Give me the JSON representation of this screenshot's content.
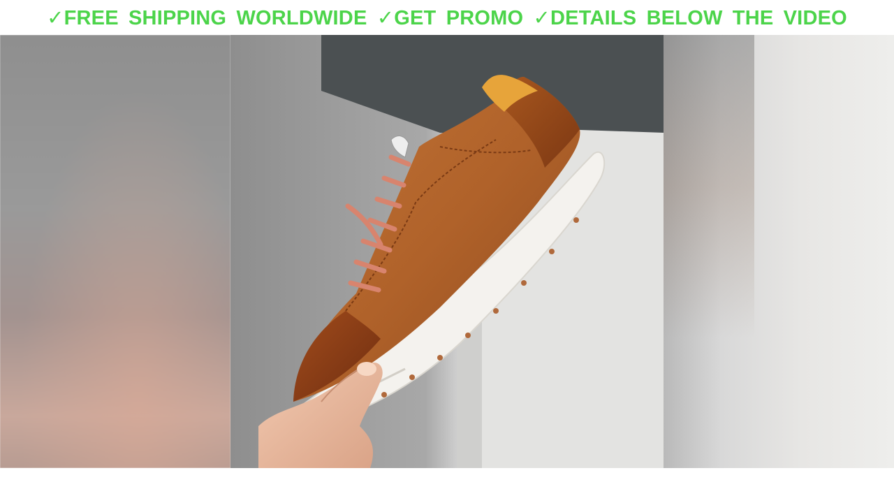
{
  "banner": {
    "text": "✓FREE SHIPPING WORLDWIDE ✓GET PROMO ✓DETAILS BELOW THE VIDEO"
  },
  "colors": {
    "banner_text": "#4cd44a",
    "shoe_leather": "#b5652a",
    "shoe_toe": "#8a3c17",
    "shoe_heel_tab": "#e7a43a",
    "laces": "#d8846e",
    "sole": "#f4f2ee"
  },
  "image": {
    "subject": "photo-of-leather-sneaker-held-in-hand"
  }
}
